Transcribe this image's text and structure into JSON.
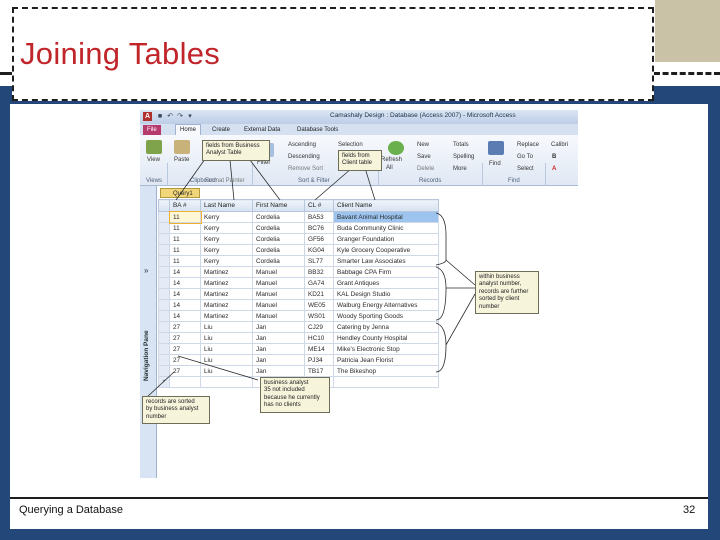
{
  "slide": {
    "title": "Joining Tables",
    "footer_left": "Querying a Database",
    "page_number": "32"
  },
  "window": {
    "title": "Camashaly Design : Database (Access 2007) - Microsoft Access",
    "app_letter": "A"
  },
  "ribbon": {
    "tabs": [
      "File",
      "Home",
      "Create",
      "External Data",
      "Database Tools"
    ],
    "active_tab": "Home",
    "views_label": "View",
    "paste_label": "Paste",
    "filter_label": "Filter",
    "format_painter": "Format Painter",
    "ascending": "Ascending",
    "descending": "Descending",
    "remove_sort": "Remove Sort",
    "selection": "Selection",
    "refresh": "Refresh",
    "refresh_all": "All",
    "new": "New",
    "save": "Save",
    "delete": "Delete",
    "totals": "Totals",
    "spelling": "Spelling",
    "more": "More",
    "find": "Find",
    "replace": "Replace",
    "goto": "Go To",
    "select": "Select",
    "font_name": "Calibri",
    "group_views": "Views",
    "group_clipboard": "Clipboard",
    "group_sort_filter": "Sort & Filter",
    "group_records": "Records",
    "group_find": "Find"
  },
  "nav": {
    "label": "Navigation Pane",
    "arrows": "»"
  },
  "query": {
    "tab_label": "Query1",
    "columns": [
      "BA #",
      "Last Name",
      "First Name",
      "CL #",
      "Client Name"
    ],
    "rows": [
      [
        "11",
        "Kerry",
        "Cordelia",
        "BA53",
        "Bavant Animal Hospital"
      ],
      [
        "11",
        "Kerry",
        "Cordelia",
        "BC76",
        "Buda Community Clinic"
      ],
      [
        "11",
        "Kerry",
        "Cordelia",
        "GF56",
        "Granger Foundation"
      ],
      [
        "11",
        "Kerry",
        "Cordelia",
        "KG04",
        "Kyle Grocery Cooperative"
      ],
      [
        "11",
        "Kerry",
        "Cordelia",
        "SL77",
        "Smarter Law Associates"
      ],
      [
        "14",
        "Martinez",
        "Manuel",
        "BB32",
        "Babbage CPA Firm"
      ],
      [
        "14",
        "Martinez",
        "Manuel",
        "GA74",
        "Grant Antiques"
      ],
      [
        "14",
        "Martinez",
        "Manuel",
        "KD21",
        "KAL Design Studio"
      ],
      [
        "14",
        "Martinez",
        "Manuel",
        "WE05",
        "Walburg Energy Alternatives"
      ],
      [
        "14",
        "Martinez",
        "Manuel",
        "WS01",
        "Woody Sporting Goods"
      ],
      [
        "27",
        "Liu",
        "Jan",
        "CJ29",
        "Catering by Jenna"
      ],
      [
        "27",
        "Liu",
        "Jan",
        "HC10",
        "Hendley County Hospital"
      ],
      [
        "27",
        "Liu",
        "Jan",
        "ME14",
        "Mike's Electronic Stop"
      ],
      [
        "27",
        "Liu",
        "Jan",
        "PJ34",
        "Patricia Jean Florist"
      ],
      [
        "27",
        "Liu",
        "Jan",
        "TB17",
        "The Bikeshop"
      ]
    ],
    "new_row_marker": "*"
  },
  "callouts": {
    "business_analyst_fields": [
      "fields from Business",
      "Analyst Table"
    ],
    "client_fields": [
      "fields from",
      "Client table"
    ],
    "within_analyst": [
      "within business",
      "analyst number,",
      "records are further",
      "sorted by client",
      "number"
    ],
    "not_included": [
      "business analyst",
      "35 not included",
      "because he currently",
      "has no clients"
    ],
    "sorted_by_analyst": [
      "records are sorted",
      "by business analyst",
      "number"
    ]
  },
  "colors": {
    "title_red": "#c0252a",
    "frame_blue": "#24477a",
    "corner_tan": "#c9c2a6",
    "file_tab": "#b73a6d"
  }
}
